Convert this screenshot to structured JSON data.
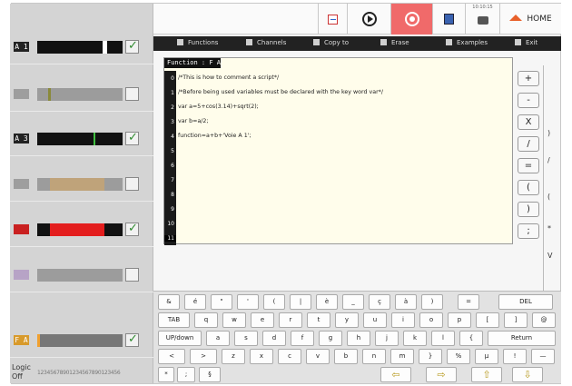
{
  "channels": [
    {
      "label": "A 1",
      "active": true,
      "checked": true
    },
    {
      "label": "",
      "active": false,
      "checked": false
    },
    {
      "label": "A 3",
      "active": true,
      "checked": true
    },
    {
      "label": "",
      "active": false,
      "checked": false
    },
    {
      "label": "",
      "active": true,
      "checked": true
    },
    {
      "label": "",
      "active": false,
      "checked": false
    },
    {
      "label": "F A",
      "active": true,
      "checked": true
    }
  ],
  "logic": {
    "label": "Logic",
    "state": "Off",
    "digits": "12345678901234567890123456"
  },
  "toolbar": {
    "home_label": "HOME",
    "clock_label": "10:10:15"
  },
  "menu": {
    "functions": "Functions",
    "channels": "Channels",
    "copy_to": "Copy to",
    "erase": "Erase",
    "examples": "Examples",
    "exit": "Exit"
  },
  "editor": {
    "title": "Function : F A",
    "line_numbers": [
      "0",
      "1",
      "2",
      "3",
      "4",
      "5",
      "6",
      "7",
      "8",
      "9",
      "10",
      "11"
    ],
    "lines": [
      "/*This is how to comment a script*/",
      "/*Before being used variables must be declared with the key word var*/",
      "var a=5+cos(3.14)+sqrt(2);",
      "var b=a/2;",
      "function=a+b+'Voie A 1';"
    ]
  },
  "operators": [
    "+",
    "-",
    "X",
    "/",
    "=",
    "(",
    ")",
    ";"
  ],
  "keyboard": {
    "row1": [
      "&",
      "é",
      "\"",
      "'",
      "(",
      "|",
      "è",
      "_",
      "ç",
      "à",
      ")",
      "=",
      "DEL"
    ],
    "row2": [
      "TAB",
      "q",
      "w",
      "e",
      "r",
      "t",
      "y",
      "u",
      "i",
      "o",
      "p",
      "[",
      "]",
      "@"
    ],
    "row3": [
      "UP/down",
      "a",
      "s",
      "d",
      "f",
      "g",
      "h",
      "j",
      "k",
      "l",
      "{",
      "Return"
    ],
    "row4": [
      "<",
      ">",
      "z",
      "x",
      "c",
      "v",
      "b",
      "n",
      "m",
      "}",
      "%",
      "µ",
      "!",
      "—"
    ],
    "row5": [
      "*",
      ";",
      "§"
    ]
  }
}
